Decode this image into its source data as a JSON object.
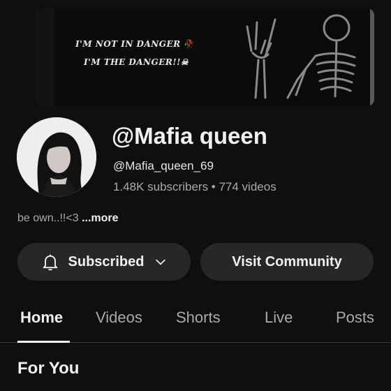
{
  "banner": {
    "line1": "I'M NOT IN DANGER",
    "line2": "I'M THE DANGER!!☠",
    "rose": "🥀"
  },
  "channel": {
    "name": "@Mafia queen",
    "handle": "@Mafia_queen_69",
    "stats": "1.48K subscribers • 774 videos",
    "description": "be own..!!<3",
    "more": "...more"
  },
  "actions": {
    "subscribed_label": "Subscribed",
    "community_label": "Visit Community"
  },
  "tabs": [
    {
      "label": "Home",
      "active": true
    },
    {
      "label": "Videos",
      "active": false
    },
    {
      "label": "Shorts",
      "active": false
    },
    {
      "label": "Live",
      "active": false
    },
    {
      "label": "Posts",
      "active": false
    }
  ],
  "section": {
    "title": "For You"
  },
  "colors": {
    "background": "#0f0f0f",
    "button": "#272727",
    "text_primary": "#f1f1f1",
    "text_secondary": "#aaaaaa"
  }
}
